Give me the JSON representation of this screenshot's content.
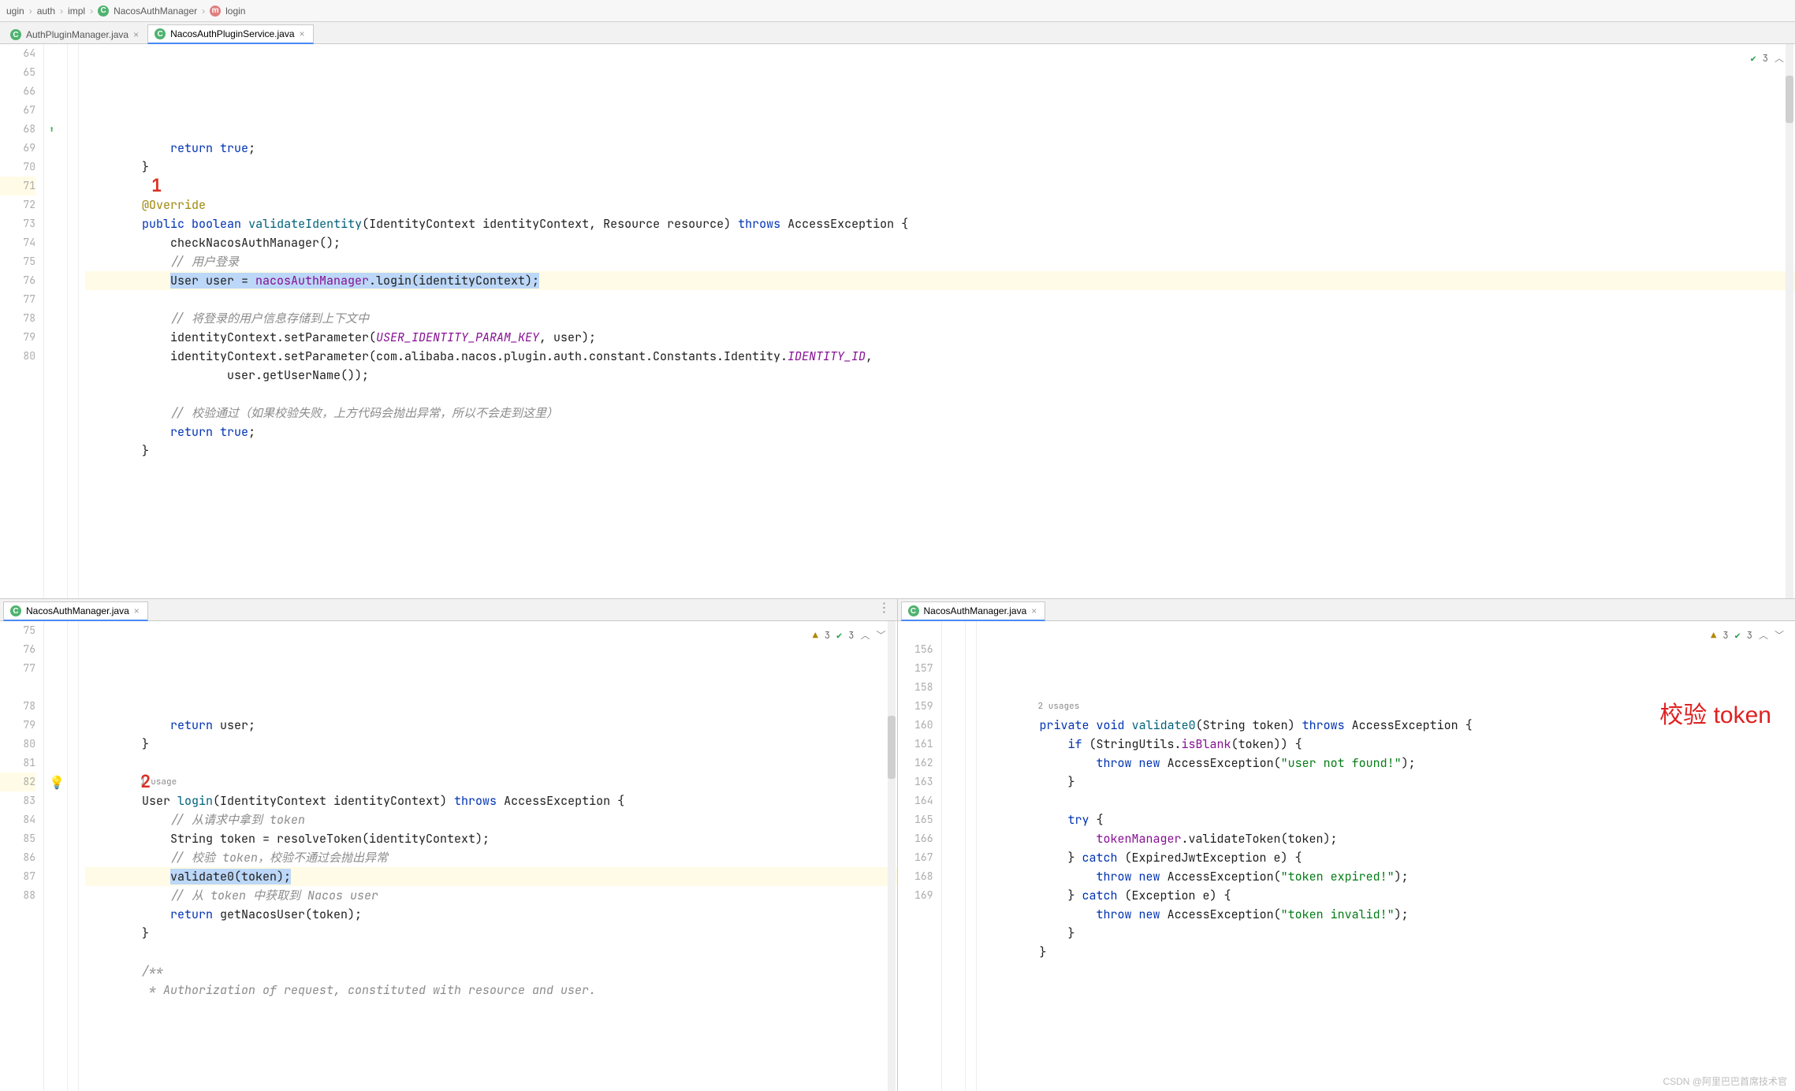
{
  "breadcrumb": {
    "items": [
      "ugin",
      "auth",
      "impl",
      "NacosAuthManager",
      "login"
    ]
  },
  "top": {
    "tabs": [
      {
        "label": "AuthPluginManager.java",
        "active": false
      },
      {
        "label": "NacosAuthPluginService.java",
        "active": true
      }
    ],
    "badge": {
      "ok_count": "3"
    },
    "red_marker": "1",
    "lines": [
      {
        "n": 64,
        "tokens": [
          [
            "txt",
            "            "
          ],
          [
            "kw",
            "return"
          ],
          [
            "txt",
            " "
          ],
          [
            "kw",
            "true"
          ],
          [
            "txt",
            ";"
          ]
        ]
      },
      {
        "n": 65,
        "tokens": [
          [
            "txt",
            "        }"
          ]
        ]
      },
      {
        "n": 66,
        "tokens": [
          [
            "txt",
            ""
          ]
        ]
      },
      {
        "n": 67,
        "tokens": [
          [
            "txt",
            "        "
          ],
          [
            "ann",
            "@Override"
          ]
        ]
      },
      {
        "n": 68,
        "marker": "impl-up",
        "tokens": [
          [
            "txt",
            "        "
          ],
          [
            "kw",
            "public"
          ],
          [
            "txt",
            " "
          ],
          [
            "kw",
            "boolean"
          ],
          [
            "txt",
            " "
          ],
          [
            "mth",
            "validateIdentity"
          ],
          [
            "txt",
            "(IdentityContext identityContext, Resource resource) "
          ],
          [
            "kw",
            "throws"
          ],
          [
            "txt",
            " AccessException {"
          ]
        ]
      },
      {
        "n": 69,
        "tokens": [
          [
            "txt",
            "            checkNacosAuthManager();"
          ]
        ]
      },
      {
        "n": 70,
        "tokens": [
          [
            "txt",
            "            "
          ],
          [
            "cmt",
            "// 用户登录"
          ]
        ]
      },
      {
        "n": 71,
        "hl": true,
        "tokens": [
          [
            "txt",
            "            "
          ],
          [
            "sel",
            "User user = "
          ],
          [
            "sel-id",
            "nacosAuthManager"
          ],
          [
            "sel",
            ".login(identityContext);"
          ]
        ]
      },
      {
        "n": 72,
        "tokens": [
          [
            "txt",
            ""
          ]
        ]
      },
      {
        "n": 73,
        "tokens": [
          [
            "txt",
            "            "
          ],
          [
            "cmt",
            "// 将登录的用户信息存储到上下文中"
          ]
        ]
      },
      {
        "n": 74,
        "tokens": [
          [
            "txt",
            "            identityContext.setParameter("
          ],
          [
            "id",
            "USER_IDENTITY_PARAM_KEY"
          ],
          [
            "txt",
            ", user);"
          ]
        ]
      },
      {
        "n": 75,
        "tokens": [
          [
            "txt",
            "            identityContext.setParameter(com.alibaba.nacos.plugin.auth.constant.Constants.Identity."
          ],
          [
            "id",
            "IDENTITY_ID"
          ],
          [
            "txt",
            ","
          ]
        ]
      },
      {
        "n": 76,
        "tokens": [
          [
            "txt",
            "                    user.getUserName());"
          ]
        ]
      },
      {
        "n": 77,
        "tokens": [
          [
            "txt",
            ""
          ]
        ]
      },
      {
        "n": 78,
        "tokens": [
          [
            "txt",
            "            "
          ],
          [
            "cmt",
            "// 校验通过（如果校验失败，上方代码会抛出异常，所以不会走到这里）"
          ]
        ]
      },
      {
        "n": 79,
        "tokens": [
          [
            "txt",
            "            "
          ],
          [
            "kw",
            "return"
          ],
          [
            "txt",
            " "
          ],
          [
            "kw",
            "true"
          ],
          [
            "txt",
            ";"
          ]
        ]
      },
      {
        "n": 80,
        "tokens": [
          [
            "txt",
            "        }"
          ]
        ]
      }
    ]
  },
  "botLeft": {
    "tabs": [
      {
        "label": "NacosAuthManager.java",
        "active": true
      }
    ],
    "badge": {
      "warn_count": "3",
      "ok_count": "3"
    },
    "red_marker": "2",
    "usage_label": "1 usage",
    "lines": [
      {
        "n": 75,
        "tokens": [
          [
            "txt",
            "            "
          ],
          [
            "kw",
            "return"
          ],
          [
            "txt",
            " user;"
          ]
        ]
      },
      {
        "n": 76,
        "tokens": [
          [
            "txt",
            "        }"
          ]
        ]
      },
      {
        "n": 77,
        "tokens": [
          [
            "txt",
            ""
          ]
        ]
      },
      {
        "n": "",
        "usage": true
      },
      {
        "n": 78,
        "tokens": [
          [
            "txt",
            "        User "
          ],
          [
            "mth",
            "login"
          ],
          [
            "txt",
            "(IdentityContext identityContext) "
          ],
          [
            "kw",
            "throws"
          ],
          [
            "txt",
            " AccessException {"
          ]
        ]
      },
      {
        "n": 79,
        "tokens": [
          [
            "txt",
            "            "
          ],
          [
            "cmt",
            "// 从请求中拿到 token"
          ]
        ]
      },
      {
        "n": 80,
        "tokens": [
          [
            "txt",
            "            String token = resolveToken(identityContext);"
          ]
        ]
      },
      {
        "n": 81,
        "tokens": [
          [
            "txt",
            "            "
          ],
          [
            "cmt",
            "// 校验 token，校验不通过会抛出异常"
          ]
        ]
      },
      {
        "n": 82,
        "hl": true,
        "bulb": true,
        "tokens": [
          [
            "txt",
            "            "
          ],
          [
            "sel",
            "validate0(token);"
          ]
        ]
      },
      {
        "n": 83,
        "tokens": [
          [
            "txt",
            "            "
          ],
          [
            "cmt",
            "// 从 token 中获取到 Nacos user"
          ]
        ]
      },
      {
        "n": 84,
        "tokens": [
          [
            "txt",
            "            "
          ],
          [
            "kw",
            "return"
          ],
          [
            "txt",
            " getNacosUser(token);"
          ]
        ]
      },
      {
        "n": 85,
        "tokens": [
          [
            "txt",
            "        }"
          ]
        ]
      },
      {
        "n": 86,
        "tokens": [
          [
            "txt",
            ""
          ]
        ]
      },
      {
        "n": 87,
        "tokens": [
          [
            "txt",
            "        "
          ],
          [
            "cmt",
            "/**"
          ]
        ]
      },
      {
        "n": 88,
        "tokens": [
          [
            "txt",
            "         "
          ],
          [
            "cmt",
            "* Authorization of request, constituted with resource and user."
          ]
        ]
      }
    ]
  },
  "botRight": {
    "tabs": [
      {
        "label": "NacosAuthManager.java",
        "active": true
      }
    ],
    "badge": {
      "warn_count": "3",
      "ok_count": "3"
    },
    "big_red_label": "校验 token",
    "usage_label": "2 usages",
    "lines": [
      {
        "n": "",
        "usage": true
      },
      {
        "n": 156,
        "tokens": [
          [
            "txt",
            "        "
          ],
          [
            "kw",
            "private"
          ],
          [
            "txt",
            " "
          ],
          [
            "kw",
            "void"
          ],
          [
            "txt",
            " "
          ],
          [
            "mth",
            "validate0"
          ],
          [
            "txt",
            "(String token) "
          ],
          [
            "kw",
            "throws"
          ],
          [
            "txt",
            " AccessException {"
          ]
        ]
      },
      {
        "n": 157,
        "tokens": [
          [
            "txt",
            "            "
          ],
          [
            "kw",
            "if"
          ],
          [
            "txt",
            " (StringUtils."
          ],
          [
            "fld",
            "isBlank"
          ],
          [
            "txt",
            "(token)) {"
          ]
        ]
      },
      {
        "n": 158,
        "tokens": [
          [
            "txt",
            "                "
          ],
          [
            "kw",
            "throw"
          ],
          [
            "txt",
            " "
          ],
          [
            "kw",
            "new"
          ],
          [
            "txt",
            " AccessException("
          ],
          [
            "str",
            "\"user not found!\""
          ],
          [
            "txt",
            ");"
          ]
        ]
      },
      {
        "n": 159,
        "tokens": [
          [
            "txt",
            "            }"
          ]
        ]
      },
      {
        "n": 160,
        "tokens": [
          [
            "txt",
            ""
          ]
        ]
      },
      {
        "n": 161,
        "tokens": [
          [
            "txt",
            "            "
          ],
          [
            "kw",
            "try"
          ],
          [
            "txt",
            " {"
          ]
        ]
      },
      {
        "n": 162,
        "tokens": [
          [
            "txt",
            "                "
          ],
          [
            "fld",
            "tokenManager"
          ],
          [
            "txt",
            ".validateToken(token);"
          ]
        ]
      },
      {
        "n": 163,
        "tokens": [
          [
            "txt",
            "            } "
          ],
          [
            "kw",
            "catch"
          ],
          [
            "txt",
            " (ExpiredJwtException e) {"
          ]
        ]
      },
      {
        "n": 164,
        "tokens": [
          [
            "txt",
            "                "
          ],
          [
            "kw",
            "throw"
          ],
          [
            "txt",
            " "
          ],
          [
            "kw",
            "new"
          ],
          [
            "txt",
            " AccessException("
          ],
          [
            "str",
            "\"token expired!\""
          ],
          [
            "txt",
            ");"
          ]
        ]
      },
      {
        "n": 165,
        "tokens": [
          [
            "txt",
            "            } "
          ],
          [
            "kw",
            "catch"
          ],
          [
            "txt",
            " (Exception e) {"
          ]
        ]
      },
      {
        "n": 166,
        "tokens": [
          [
            "txt",
            "                "
          ],
          [
            "kw",
            "throw"
          ],
          [
            "txt",
            " "
          ],
          [
            "kw",
            "new"
          ],
          [
            "txt",
            " AccessException("
          ],
          [
            "str",
            "\"token invalid!\""
          ],
          [
            "txt",
            ");"
          ]
        ]
      },
      {
        "n": 167,
        "tokens": [
          [
            "txt",
            "            }"
          ]
        ]
      },
      {
        "n": 168,
        "tokens": [
          [
            "txt",
            "        }"
          ]
        ]
      },
      {
        "n": 169,
        "tokens": [
          [
            "txt",
            ""
          ]
        ]
      }
    ]
  },
  "watermark": "CSDN @阿里巴巴首席技术官"
}
